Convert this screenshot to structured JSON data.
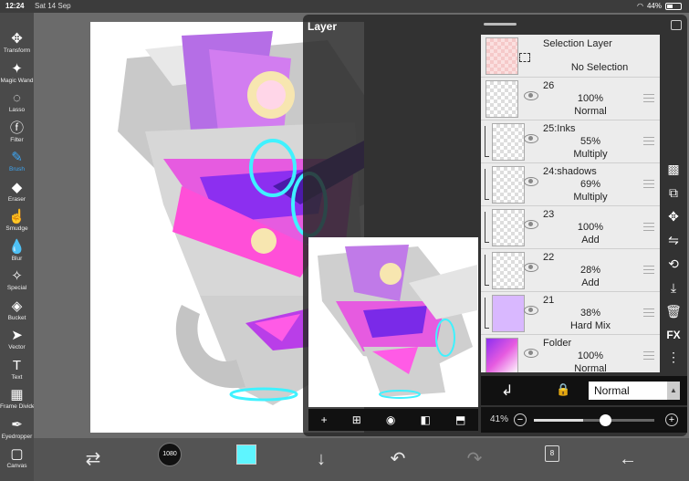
{
  "status": {
    "time": "12:24",
    "date": "Sat 14 Sep",
    "battery": "44%"
  },
  "tools": [
    {
      "label": "Transform",
      "icon": "move-icon",
      "glyph": "✥"
    },
    {
      "label": "Magic Wand",
      "icon": "magic-wand-icon",
      "glyph": "✦"
    },
    {
      "label": "Lasso",
      "icon": "lasso-icon",
      "glyph": "◌"
    },
    {
      "label": "Filter",
      "icon": "fx-icon",
      "glyph": "ⓕ"
    },
    {
      "label": "Brush",
      "icon": "brush-icon",
      "glyph": "✎"
    },
    {
      "label": "Eraser",
      "icon": "eraser-icon",
      "glyph": "◆"
    },
    {
      "label": "Smudge",
      "icon": "smudge-icon",
      "glyph": "☝"
    },
    {
      "label": "Blur",
      "icon": "blur-drop-icon",
      "glyph": "💧"
    },
    {
      "label": "Special",
      "icon": "special-icon",
      "glyph": "✧"
    },
    {
      "label": "Bucket",
      "icon": "bucket-icon",
      "glyph": "◈"
    },
    {
      "label": "Vector",
      "icon": "vector-cursor-icon",
      "glyph": "➤"
    },
    {
      "label": "Text",
      "icon": "text-icon",
      "glyph": "T"
    },
    {
      "label": "Frame Divider",
      "icon": "frame-divider-icon",
      "glyph": "▦"
    },
    {
      "label": "Eyedropper",
      "icon": "eyedropper-icon",
      "glyph": "✒"
    },
    {
      "label": "Canvas",
      "icon": "canvas-icon",
      "glyph": "▢"
    }
  ],
  "active_tool": "Brush",
  "bottom": {
    "brush_size": "1080",
    "color": "#5ef5ff",
    "page_count": "8"
  },
  "layer_panel": {
    "title": "Layer",
    "selection_layer": {
      "name": "Selection Layer",
      "state": "No Selection"
    },
    "layers": [
      {
        "name": "26",
        "opacity": "100%",
        "blend": "Normal",
        "clipped": false
      },
      {
        "name": "25:Inks",
        "opacity": "55%",
        "blend": "Multiply",
        "clipped": true
      },
      {
        "name": "24:shadows",
        "opacity": "69%",
        "blend": "Multiply",
        "clipped": true
      },
      {
        "name": "23",
        "opacity": "100%",
        "blend": "Add",
        "clipped": true
      },
      {
        "name": "22",
        "opacity": "28%",
        "blend": "Add",
        "clipped": true
      },
      {
        "name": "21",
        "opacity": "38%",
        "blend": "Hard Mix",
        "clipped": true
      },
      {
        "name": "Folder",
        "opacity": "100%",
        "blend": "Normal",
        "clipped": false
      }
    ],
    "blend_mode": "Normal",
    "zoom": "41%",
    "zoom_fraction": 0.41,
    "side_fx": "FX"
  }
}
